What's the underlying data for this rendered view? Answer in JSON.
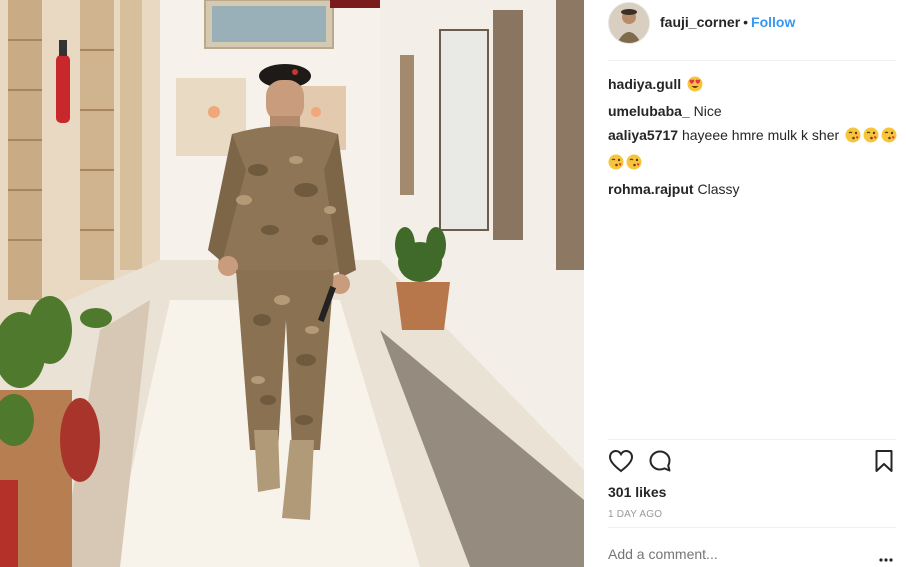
{
  "post": {
    "username": "fauji_corner",
    "separator": "•",
    "follow_label": "Follow",
    "likes": "301 likes",
    "time_ago": "1 DAY AGO",
    "comment_placeholder": "Add a comment...",
    "comments": [
      {
        "user": "hadiya.gull",
        "text": "",
        "emojis": [
          "heart-eyes"
        ]
      },
      {
        "user": "umelubaba_",
        "text": "Nice",
        "emojis": []
      },
      {
        "user": "aaliya5717",
        "text": "hayeee hmre mulk k sher",
        "emojis": [
          "kiss",
          "kiss",
          "kiss",
          "kiss",
          "kiss"
        ]
      },
      {
        "user": "rohma.rajput",
        "text": "Classy",
        "emojis": []
      }
    ]
  },
  "icons": {
    "like": "heart-icon",
    "comment": "comment-icon",
    "save": "bookmark-icon",
    "more": "more-options-icon"
  },
  "colors": {
    "follow": "#3897f0",
    "text": "#262626",
    "muted": "#999999",
    "divider": "#efefef"
  }
}
